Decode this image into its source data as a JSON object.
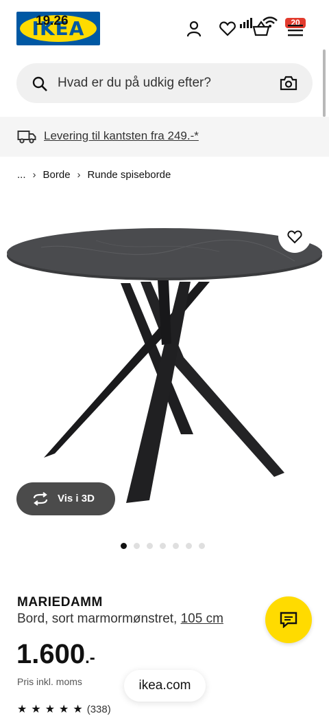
{
  "status": {
    "time": "19.26",
    "battery": "20"
  },
  "header": {
    "logo_text": "IKEA"
  },
  "search": {
    "placeholder": "Hvad er du på udkig efter?"
  },
  "banner": {
    "text": "Levering til kantsten fra 249.-*"
  },
  "breadcrumb": {
    "items": [
      "...",
      "Borde",
      "Runde spiseborde"
    ]
  },
  "gallery": {
    "vis3d_label": "Vis i 3D",
    "dot_count": 7,
    "active_index": 0
  },
  "product": {
    "name": "MARIEDAMM",
    "description": "Bord, sort marmormønstret, ",
    "size": "105 cm",
    "price": "1.600",
    "price_suffix": ".-",
    "vat_note": "Pris inkl. moms",
    "rating_count": "(338)",
    "rating": 4.5
  },
  "browser": {
    "url": "ikea.com"
  },
  "colors": {
    "ikea_blue": "#0058a3",
    "ikea_yellow": "#ffdb00"
  }
}
